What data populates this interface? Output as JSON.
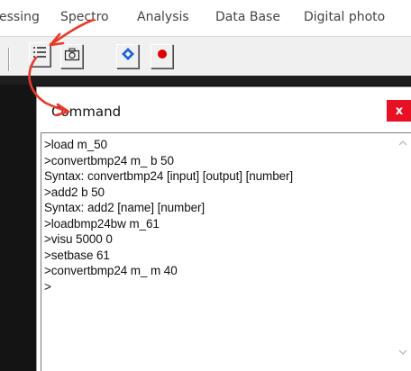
{
  "menubar": {
    "items": [
      {
        "label": "essing"
      },
      {
        "label": "Spectro"
      },
      {
        "label": "Analysis"
      },
      {
        "label": "Data Base"
      },
      {
        "label": "Digital photo"
      }
    ]
  },
  "toolbar": {
    "buttons": [
      {
        "icon": "list-icon"
      },
      {
        "icon": "camera-icon"
      },
      {
        "icon": "blue-diamond-icon"
      },
      {
        "icon": "record-icon"
      }
    ]
  },
  "command_window": {
    "title": "Command",
    "close_label": "x",
    "lines": [
      ">load m_50",
      ">convertbmp24 m_ b 50",
      "Syntax: convertbmp24 [input] [output] [number]",
      ">add2 b 50",
      "Syntax: add2 [name] [number]",
      ">loadbmp24bw m_61",
      ">visu 5000 0",
      ">setbase 61",
      ">convertbmp24 m_ m 40",
      ">"
    ]
  },
  "colors": {
    "annotation_arrow": "#e8392a",
    "close_button": "#e81123",
    "record_dot": "#e00000",
    "diamond_blue": "#1e63d8"
  }
}
